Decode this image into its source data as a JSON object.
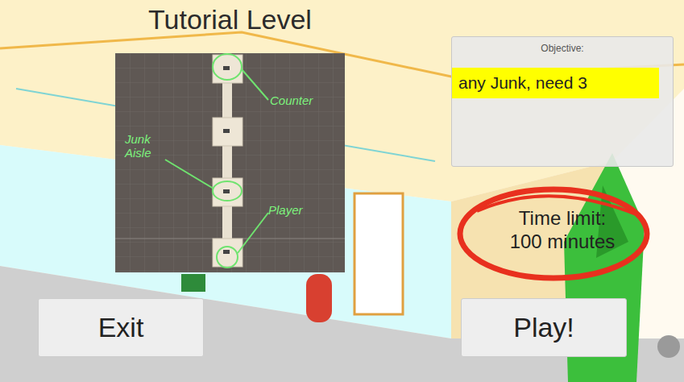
{
  "screen": {
    "title": "Tutorial Level"
  },
  "map": {
    "annotations": [
      {
        "label": "Counter"
      },
      {
        "label": "Junk Aisle"
      },
      {
        "label": "Player"
      }
    ]
  },
  "objective": {
    "label": "Objective:",
    "items": [
      {
        "text": "any Junk, need 3",
        "selected": true
      }
    ]
  },
  "time_limit": {
    "label": "Time limit:",
    "value": "100 minutes"
  },
  "buttons": [
    {
      "label": "Exit"
    },
    {
      "label": "Play!"
    }
  ]
}
